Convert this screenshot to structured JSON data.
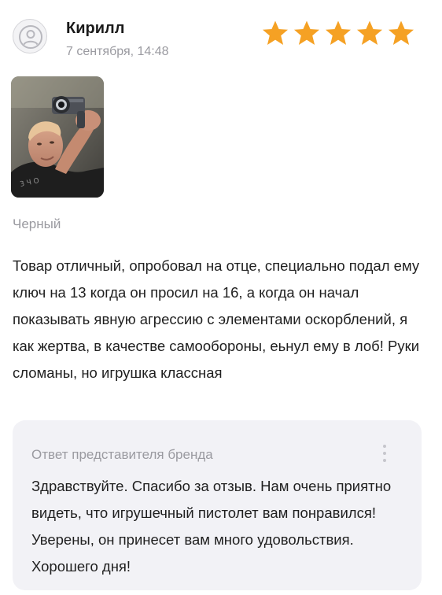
{
  "review": {
    "author_name": "Кирилл",
    "date": "7 сентября, 14:48",
    "rating": 5,
    "rating_max": 5,
    "star_color": "#f5a124",
    "photo_icon": "user-photo",
    "variant": "Черный",
    "text": "Товар отличный, опробовал на отце, специально подал ему ключ на 13 когда он просил на 16, а когда он начал показывать явную агрессию с элементами оскорблений, я как жертва, в качестве самообороны, еьнул ему в лоб! Руки сломаны, но игрушка классная"
  },
  "reply": {
    "title": "Ответ представителя бренда",
    "text": "Здравствуйте. Спасибо за отзыв. Нам очень приятно видеть, что игрушечный пистолет вам понравился! Уверены, он принесет вам много удовольствия. Хорошего дня!",
    "menu_icon": "more-vertical-icon"
  }
}
